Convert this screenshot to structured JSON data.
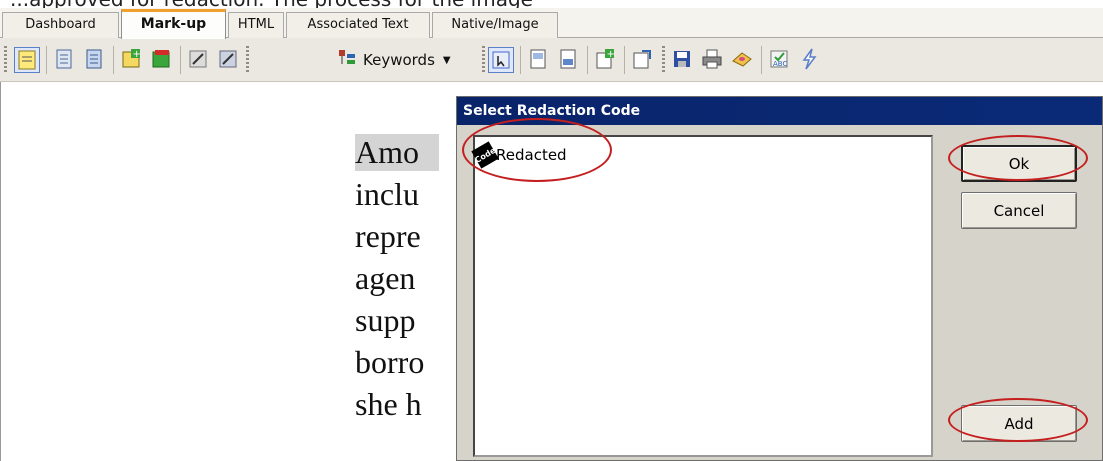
{
  "caption": {
    "text": "...approved for redaction. The process for the image"
  },
  "tabs": [
    {
      "label": "Dashboard",
      "active": false
    },
    {
      "label": "Mark-up",
      "active": true
    },
    {
      "label": "HTML",
      "active": false
    },
    {
      "label": "Associated Text",
      "active": false
    },
    {
      "label": "Native/Image",
      "active": false
    }
  ],
  "toolbar": {
    "keywords_label": "Keywords",
    "icons": [
      "highlight-icon",
      "note-icon",
      "note-list-icon",
      "add-redaction-icon",
      "remove-redaction-icon",
      "edit-icon",
      "edit-all-icon",
      "keywords-icon",
      "select-icon",
      "page-icon",
      "page-next-icon",
      "add-page-icon",
      "export-icon",
      "save-icon",
      "print-icon",
      "eraser-icon",
      "spell-check-icon",
      "lightning-icon"
    ]
  },
  "document": {
    "lines": [
      "Amo",
      "inclu",
      "repre",
      "agen",
      "supp",
      "borro",
      "she h"
    ]
  },
  "dialog": {
    "title": "Select Redaction Code",
    "items": [
      {
        "icon_text": "Code",
        "label": "Redacted"
      }
    ],
    "ok_label": "Ok",
    "cancel_label": "Cancel",
    "add_label": "Add"
  },
  "colors": {
    "annotation_red": "#c41e1e",
    "titlebar": "#0a246a",
    "accent_tab": "#f0a030"
  }
}
